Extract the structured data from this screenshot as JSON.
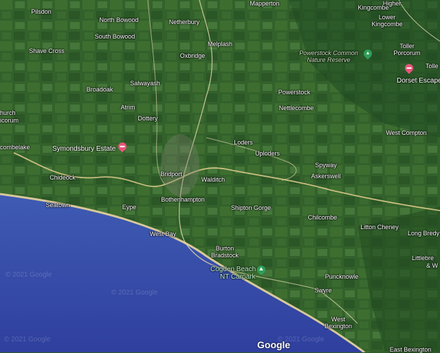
{
  "map": {
    "places": [
      {
        "id": "pilsdon",
        "text": "Pilsdon"
      },
      {
        "id": "north-bowood",
        "text": "North Bowood"
      },
      {
        "id": "netherbury",
        "text": "Netherbury"
      },
      {
        "id": "mapperton",
        "text": "Mapperton"
      },
      {
        "id": "south-bowood",
        "text": "South Bowood"
      },
      {
        "id": "melplash",
        "text": "Melplash"
      },
      {
        "id": "shave-cross",
        "text": "Shave Cross"
      },
      {
        "id": "oxbridge",
        "text": "Oxbridge"
      },
      {
        "id": "salwayash",
        "text": "Salwayash"
      },
      {
        "id": "broadoak",
        "text": "Broadoak"
      },
      {
        "id": "powerstock",
        "text": "Powerstock"
      },
      {
        "id": "atrim",
        "text": "Atrim"
      },
      {
        "id": "nettlecombe",
        "text": "Nettlecombe"
      },
      {
        "id": "church",
        "text": "hurch"
      },
      {
        "id": "icorum",
        "text": "icorum"
      },
      {
        "id": "dottery",
        "text": "Dottery"
      },
      {
        "id": "west-compton",
        "text": "West Compton"
      },
      {
        "id": "combelake",
        "text": "combelake"
      },
      {
        "id": "loders",
        "text": "Loders"
      },
      {
        "id": "uploders",
        "text": "Uploders"
      },
      {
        "id": "spyway",
        "text": "Spyway"
      },
      {
        "id": "bridport",
        "text": "Bridport"
      },
      {
        "id": "askerswell",
        "text": "Askerswell"
      },
      {
        "id": "chideock",
        "text": "Chideock"
      },
      {
        "id": "walditch",
        "text": "Walditch"
      },
      {
        "id": "bothenhampton",
        "text": "Bothenhampton"
      },
      {
        "id": "seatown",
        "text": "Seatown"
      },
      {
        "id": "eype",
        "text": "Eype"
      },
      {
        "id": "shipton-gorge",
        "text": "Shipton Gorge"
      },
      {
        "id": "chilcombe",
        "text": "Chilcombe"
      },
      {
        "id": "litton-cheney",
        "text": "Litton Cheney"
      },
      {
        "id": "long-bredy",
        "text": "Long Bredy"
      },
      {
        "id": "west-bay",
        "text": "West Bay"
      },
      {
        "id": "burton",
        "text": "Burton"
      },
      {
        "id": "bradstock",
        "text": "Bradstock"
      },
      {
        "id": "littlebre",
        "text": "Littlebre"
      },
      {
        "id": "amp-w",
        "text": "& W"
      },
      {
        "id": "puncknowle",
        "text": "Puncknowle"
      },
      {
        "id": "swyre",
        "text": "Swyre"
      },
      {
        "id": "west",
        "text": "West"
      },
      {
        "id": "bexington",
        "text": "Bexington"
      },
      {
        "id": "east-bexington",
        "text": "East Bexington"
      },
      {
        "id": "higher-kingcombe",
        "text": "Higher"
      },
      {
        "id": "kingcombe",
        "text": "Kingcombe"
      },
      {
        "id": "lower",
        "text": "Lower"
      },
      {
        "id": "lower-kingcombe",
        "text": "Kingcombe"
      },
      {
        "id": "toller",
        "text": "Toller"
      },
      {
        "id": "porcorum",
        "text": "Porcorum"
      },
      {
        "id": "tolle",
        "text": "Tolle"
      }
    ],
    "park": {
      "line1": "Powerstock Common",
      "line2": "Nature Reserve"
    },
    "pois": [
      {
        "id": "symondsbury",
        "text": "Symondsbury Estate",
        "kind": "lodging"
      },
      {
        "id": "dorset-escape",
        "text": "Dorset Escape",
        "kind": "lodging"
      },
      {
        "id": "cogden-1",
        "text": "Cogden Beach",
        "kind": "park"
      },
      {
        "id": "cogden-2",
        "text": "NT Carpark",
        "kind": "park"
      }
    ],
    "watermarks": [
      "© 2021 Google",
      "© 2021 Google",
      "© 2021 Google",
      "© 2021 Google"
    ],
    "google_logo": "Google",
    "colors": {
      "sea": "#3a4fb0",
      "land": "#2f5a2a",
      "road": "#d9d2a8",
      "shore": "#d8c89a"
    }
  }
}
